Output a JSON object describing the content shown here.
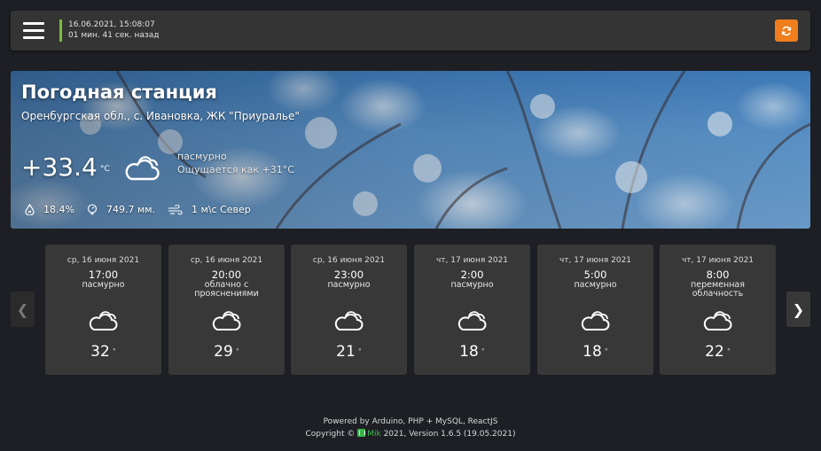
{
  "header": {
    "datetime": "16.06.2021, 15:08:07",
    "ago": "01 мин. 41 сек. назад",
    "accent_color": "#7cbd3e",
    "refresh_color": "#f07e1c"
  },
  "hero": {
    "title": "Погодная станция",
    "location": "Оренбургская обл., с. Ивановка, ЖК \"Приуралье\"",
    "temperature": "+33.4",
    "temperature_unit": "°C",
    "condition": "пасмурно",
    "feels_like": "Ощущается как +31°C",
    "condition_icon": "cloudy-icon",
    "humidity": "18.4%",
    "pressure": "749.7 мм.",
    "wind": "1 м\\с Север"
  },
  "forecast": {
    "items": [
      {
        "date": "ср, 16 июня 2021",
        "time": "17:00",
        "desc": "пасмурно",
        "temp": "32",
        "deg": "°",
        "icon": "cloudy-icon"
      },
      {
        "date": "ср, 16 июня 2021",
        "time": "20:00",
        "desc": "облачно с прояснениями",
        "temp": "29",
        "deg": "°",
        "icon": "cloudy-icon"
      },
      {
        "date": "ср, 16 июня 2021",
        "time": "23:00",
        "desc": "пасмурно",
        "temp": "21",
        "deg": "°",
        "icon": "cloudy-icon"
      },
      {
        "date": "чт, 17 июня 2021",
        "time": "2:00",
        "desc": "пасмурно",
        "temp": "18",
        "deg": "°",
        "icon": "cloudy-icon"
      },
      {
        "date": "чт, 17 июня 2021",
        "time": "5:00",
        "desc": "пасмурно",
        "temp": "18",
        "deg": "°",
        "icon": "cloudy-icon"
      },
      {
        "date": "чт, 17 июня 2021",
        "time": "8:00",
        "desc": "переменная облачность",
        "temp": "22",
        "deg": "°",
        "icon": "cloudy-icon"
      }
    ],
    "prev_label": "❮",
    "next_label": "❯"
  },
  "footer": {
    "line1": "Powered by Arduino, PHP + MySQL, ReactJS",
    "copyright_prefix": "Copyright ©",
    "brand": "Mik",
    "line2_suffix": "2021, Version 1.6.5 (19.05.2021)",
    "brand_color": "#3bb54a"
  }
}
